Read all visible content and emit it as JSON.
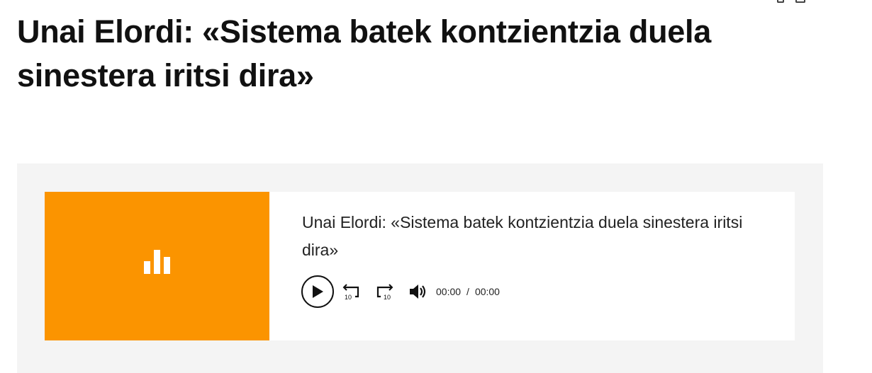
{
  "article": {
    "headline": "Unai Elordi: «Sistema batek kontzientzia duela sinestera iritsi dira»"
  },
  "player": {
    "title": "Unai Elordi: «Sistema batek kontzientzia duela sinestera iritsi dira»",
    "current_time": "00:00",
    "separator": "/",
    "duration": "00:00",
    "rewind_seconds": "10",
    "forward_seconds": "10",
    "cover_color": "#fb9400",
    "icons": {
      "cover": "audio-bars-icon",
      "play": "play-icon",
      "rewind": "rewind-10-icon",
      "forward": "forward-10-icon",
      "volume": "volume-icon"
    }
  }
}
